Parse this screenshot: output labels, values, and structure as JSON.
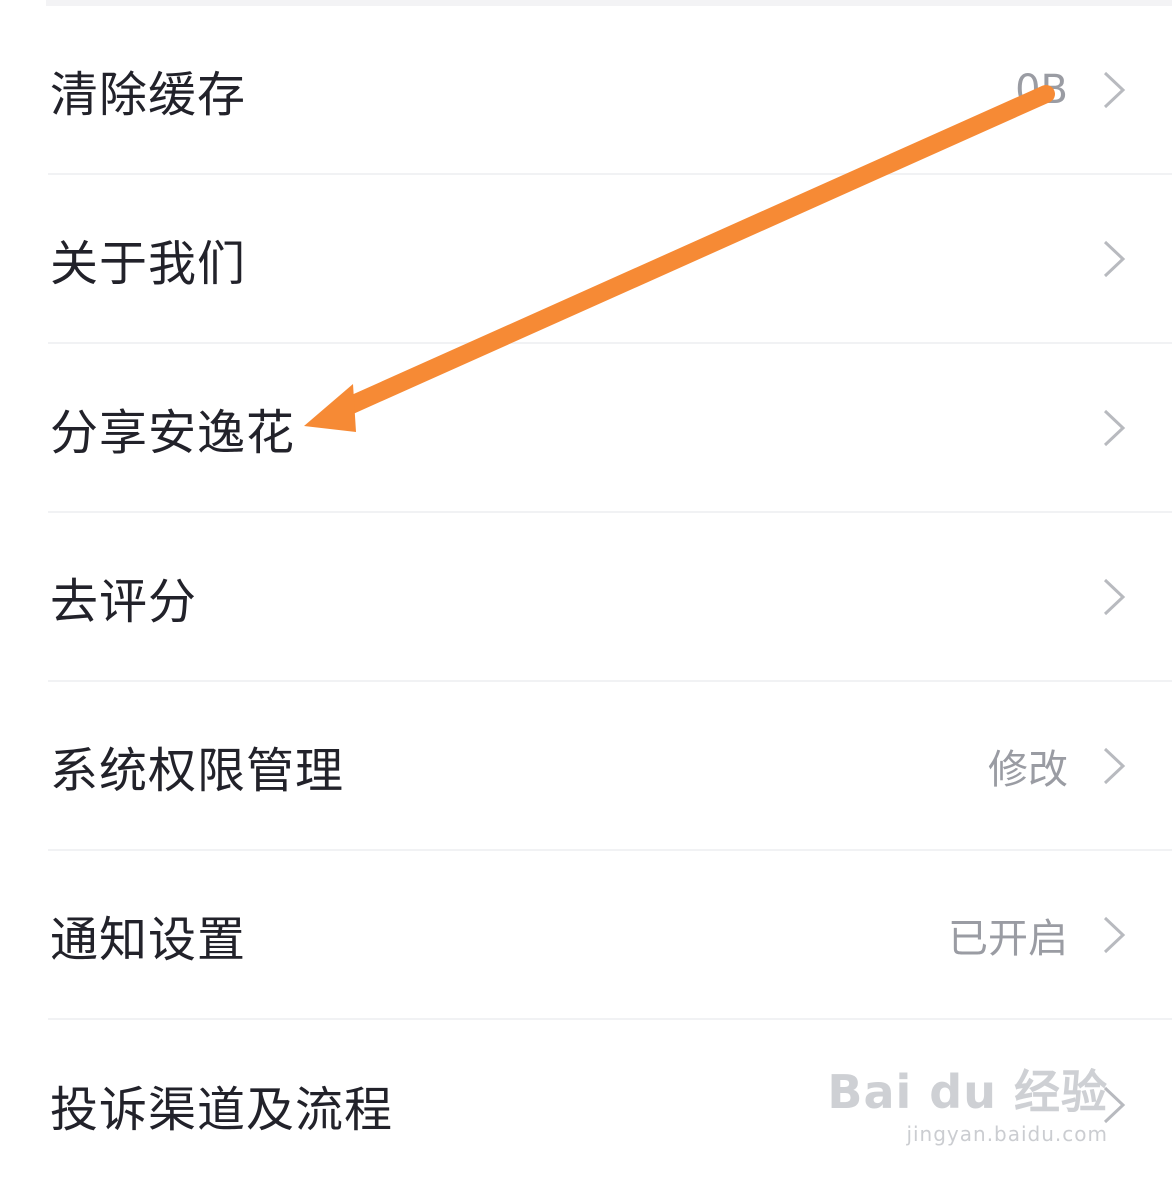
{
  "settings": {
    "items": [
      {
        "label": "清除缓存",
        "value": "0B"
      },
      {
        "label": "关于我们",
        "value": ""
      },
      {
        "label": "分享安逸花",
        "value": ""
      },
      {
        "label": "去评分",
        "value": ""
      },
      {
        "label": "系统权限管理",
        "value": "修改"
      },
      {
        "label": "通知设置",
        "value": "已开启"
      },
      {
        "label": "投诉渠道及流程",
        "value": ""
      }
    ]
  },
  "annotation": {
    "color": "#f68a35"
  },
  "watermark": {
    "logo": "Bai du 经验",
    "url": "jingyan.baidu.com"
  }
}
